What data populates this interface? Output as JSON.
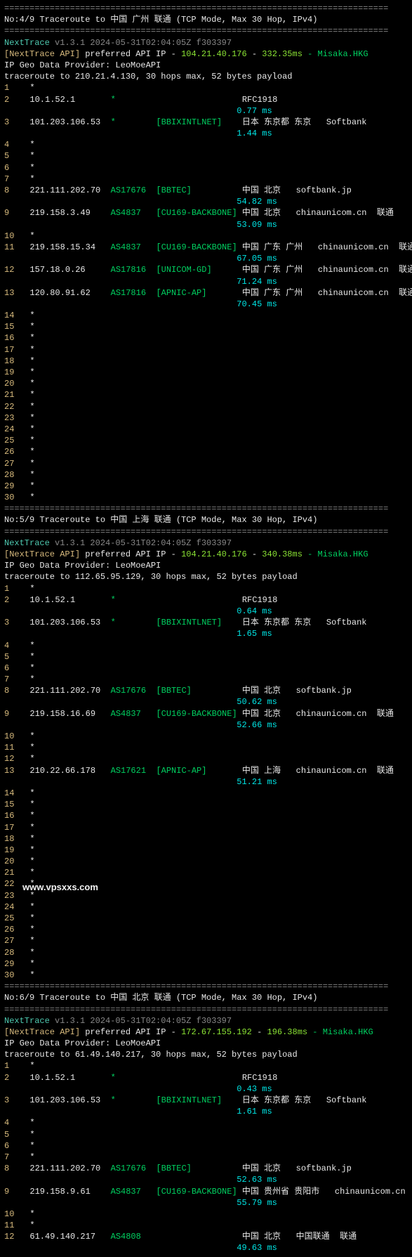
{
  "hr1": "============================================================================",
  "hr2": "----------------------------------------------------------------------------",
  "header_common": {
    "brand": "NextTrace",
    "version": "v1.3.1 2024-05-31T02:04:05Z f303397",
    "api_prefix": "[NextTrace API]",
    "api_text": " preferred API IP - ",
    "api_node": " - Misaka.HKG",
    "geo": "IP Geo Data Provider: LeoMoeAPI"
  },
  "traces": [
    {
      "title": "No:4/9 Traceroute to 中国 广州 联通 (TCP Mode, Max 30 Hop, IPv4)",
      "api_ip": "104.21.40.176",
      "api_rtt": "332.35ms",
      "target": "traceroute to 210.21.4.130, 30 hops max, 52 bytes payload",
      "hops": [
        {
          "n": "1",
          "star": true
        },
        {
          "n": "2",
          "ip": "10.1.52.1",
          "asn": "*",
          "org": "",
          "loc": "RFC1918",
          "rtt": "0.77 ms"
        },
        {
          "n": "3",
          "ip": "101.203.106.53",
          "asn": "*",
          "org": "[BBIXINTLNET]",
          "loc": "日本 东京都 东京",
          "host": "Softbank",
          "rtt": "1.44 ms"
        },
        {
          "n": "4",
          "star": true
        },
        {
          "n": "5",
          "star": true
        },
        {
          "n": "6",
          "star": true
        },
        {
          "n": "7",
          "star": true
        },
        {
          "n": "8",
          "ip": "221.111.202.70",
          "asn": "AS17676",
          "org": "[BBTEC]",
          "loc": "中国 北京",
          "host": "softbank.jp",
          "rtt": "54.82 ms"
        },
        {
          "n": "9",
          "ip": "219.158.3.49",
          "asn": "AS4837",
          "org": "[CU169-BACKBONE]",
          "loc": "中国 北京",
          "host": "chinaunicom.cn",
          "tag": "联通",
          "rtt": "53.09 ms"
        },
        {
          "n": "10",
          "star": true
        },
        {
          "n": "11",
          "ip": "219.158.15.34",
          "asn": "AS4837",
          "org": "[CU169-BACKBONE]",
          "loc": "中国 广东 广州",
          "host": "chinaunicom.cn",
          "tag": "联通",
          "rtt": "67.05 ms"
        },
        {
          "n": "12",
          "ip": "157.18.0.26",
          "asn": "AS17816",
          "org": "[UNICOM-GD]",
          "loc": "中国 广东 广州",
          "host": "chinaunicom.cn",
          "tag": "联通",
          "rtt": "71.24 ms"
        },
        {
          "n": "13",
          "ip": "120.80.91.62",
          "asn": "AS17816",
          "org": "[APNIC-AP]",
          "loc": "中国 广东 广州",
          "host": "chinaunicom.cn",
          "tag": "联通",
          "rtt": "70.45 ms"
        },
        {
          "n": "14",
          "star": true
        },
        {
          "n": "15",
          "star": true
        },
        {
          "n": "16",
          "star": true
        },
        {
          "n": "17",
          "star": true
        },
        {
          "n": "18",
          "star": true
        },
        {
          "n": "19",
          "star": true
        },
        {
          "n": "20",
          "star": true
        },
        {
          "n": "21",
          "star": true
        },
        {
          "n": "22",
          "star": true
        },
        {
          "n": "23",
          "star": true
        },
        {
          "n": "24",
          "star": true
        },
        {
          "n": "25",
          "star": true
        },
        {
          "n": "26",
          "star": true
        },
        {
          "n": "27",
          "star": true
        },
        {
          "n": "28",
          "star": true
        },
        {
          "n": "29",
          "star": true
        },
        {
          "n": "30",
          "star": true
        }
      ]
    },
    {
      "title": "No:5/9 Traceroute to 中国 上海 联通 (TCP Mode, Max 30 Hop, IPv4)",
      "api_ip": "104.21.40.176",
      "api_rtt": "340.38ms",
      "target": "traceroute to 112.65.95.129, 30 hops max, 52 bytes payload",
      "hops": [
        {
          "n": "1",
          "star": true
        },
        {
          "n": "2",
          "ip": "10.1.52.1",
          "asn": "*",
          "org": "",
          "loc": "RFC1918",
          "rtt": "0.64 ms"
        },
        {
          "n": "3",
          "ip": "101.203.106.53",
          "asn": "*",
          "org": "[BBIXINTLNET]",
          "loc": "日本 东京都 东京",
          "host": "Softbank",
          "rtt": "1.65 ms"
        },
        {
          "n": "4",
          "star": true
        },
        {
          "n": "5",
          "star": true
        },
        {
          "n": "6",
          "star": true
        },
        {
          "n": "7",
          "star": true
        },
        {
          "n": "8",
          "ip": "221.111.202.70",
          "asn": "AS17676",
          "org": "[BBTEC]",
          "loc": "中国 北京",
          "host": "softbank.jp",
          "rtt": "50.62 ms"
        },
        {
          "n": "9",
          "ip": "219.158.16.69",
          "asn": "AS4837",
          "org": "[CU169-BACKBONE]",
          "loc": "中国 北京",
          "host": "chinaunicom.cn",
          "tag": "联通",
          "rtt": "52.66 ms"
        },
        {
          "n": "10",
          "star": true
        },
        {
          "n": "11",
          "star": true
        },
        {
          "n": "12",
          "star": true
        },
        {
          "n": "13",
          "ip": "210.22.66.178",
          "asn": "AS17621",
          "org": "[APNIC-AP]",
          "loc": "中国 上海",
          "host": "chinaunicom.cn",
          "tag": "联通",
          "rtt": "51.21 ms"
        },
        {
          "n": "14",
          "star": true
        },
        {
          "n": "15",
          "star": true
        },
        {
          "n": "16",
          "star": true
        },
        {
          "n": "17",
          "star": true
        },
        {
          "n": "18",
          "star": true
        },
        {
          "n": "19",
          "star": true
        },
        {
          "n": "20",
          "star": true
        },
        {
          "n": "21",
          "star": true
        },
        {
          "n": "22",
          "star": true
        },
        {
          "n": "23",
          "star": true
        },
        {
          "n": "24",
          "star": true
        },
        {
          "n": "25",
          "star": true
        },
        {
          "n": "26",
          "star": true
        },
        {
          "n": "27",
          "star": true
        },
        {
          "n": "28",
          "star": true
        },
        {
          "n": "29",
          "star": true
        },
        {
          "n": "30",
          "star": true
        }
      ]
    },
    {
      "title": "No:6/9 Traceroute to 中国 北京 联通 (TCP Mode, Max 30 Hop, IPv4)",
      "api_ip": "172.67.155.192",
      "api_rtt": "196.38ms",
      "target": "traceroute to 61.49.140.217, 30 hops max, 52 bytes payload",
      "hops": [
        {
          "n": "1",
          "star": true
        },
        {
          "n": "2",
          "ip": "10.1.52.1",
          "asn": "*",
          "org": "",
          "loc": "RFC1918",
          "rtt": "0.43 ms"
        },
        {
          "n": "3",
          "ip": "101.203.106.53",
          "asn": "*",
          "org": "[BBIXINTLNET]",
          "loc": "日本 东京都 东京",
          "host": "Softbank",
          "rtt": "1.61 ms"
        },
        {
          "n": "4",
          "star": true
        },
        {
          "n": "5",
          "star": true
        },
        {
          "n": "6",
          "star": true
        },
        {
          "n": "7",
          "star": true
        },
        {
          "n": "8",
          "ip": "221.111.202.70",
          "asn": "AS17676",
          "org": "[BBTEC]",
          "loc": "中国 北京",
          "host": "softbank.jp",
          "rtt": "52.63 ms"
        },
        {
          "n": "9",
          "ip": "219.158.9.61",
          "asn": "AS4837",
          "org": "[CU169-BACKBONE]",
          "loc": "中国 贵州省 贵阳市",
          "host": "chinaunicom.cn",
          "rtt": "55.79 ms"
        },
        {
          "n": "10",
          "star": true
        },
        {
          "n": "11",
          "star": true
        },
        {
          "n": "12",
          "ip": "61.49.140.217",
          "asn": "AS4808",
          "org": "",
          "loc": "中国 北京",
          "host": "中国联通",
          "tag": "联通",
          "rtt": "49.63 ms"
        }
      ]
    }
  ],
  "watermark": "www.vpsxxs.com"
}
